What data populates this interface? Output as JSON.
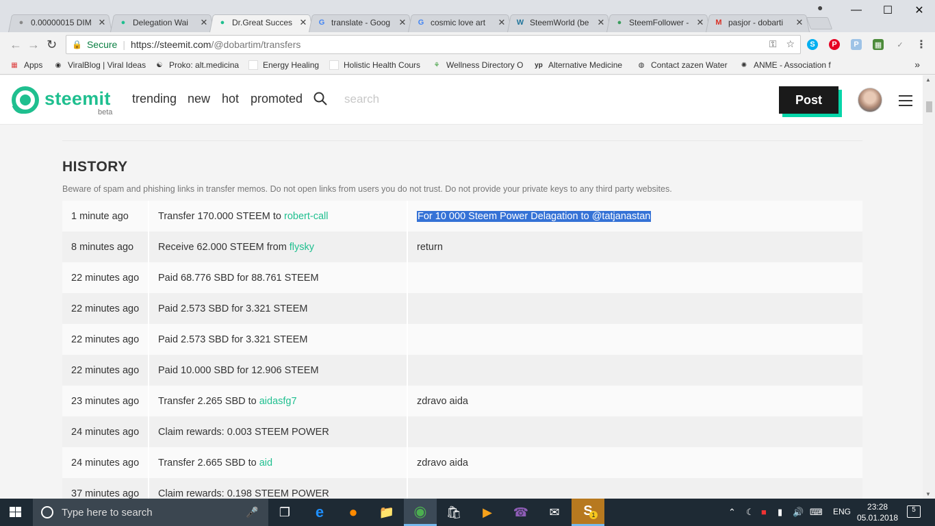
{
  "browser": {
    "tabs": [
      {
        "title": "0.00000015 DIM",
        "icon": "share-nodes-icon",
        "color": "#888888"
      },
      {
        "title": "Delegation Wai",
        "icon": "steemit-icon",
        "color": "#1fbf8f"
      },
      {
        "title": "Dr.Great Succes",
        "icon": "steemit-icon",
        "color": "#1fbf8f"
      },
      {
        "title": "translate - Goog",
        "icon": "google-icon",
        "color": "#4285f4"
      },
      {
        "title": "cosmic love art",
        "icon": "google-icon",
        "color": "#4285f4"
      },
      {
        "title": "SteemWorld (be",
        "icon": "wordpress-icon",
        "color": "#21759b"
      },
      {
        "title": "SteemFollower -",
        "icon": "steemfollower-icon",
        "color": "#3a9d5d"
      },
      {
        "title": "pasjor - dobarti",
        "icon": "gmail-icon",
        "color": "#d93025"
      }
    ],
    "address": {
      "secure_label": "Secure",
      "url_host": "https://steemit.com",
      "url_path": "/@dobartim/transfers"
    },
    "bookmarks": [
      {
        "label": "Apps",
        "icon": "apps-grid-icon"
      },
      {
        "label": "ViralBlog | Viral Ideas",
        "icon": "viralblog-icon"
      },
      {
        "label": "Proko: alt.medicina",
        "icon": "proko-icon"
      },
      {
        "label": "Energy Healing",
        "icon": "page-icon"
      },
      {
        "label": "Holistic Health Cours",
        "icon": "page-icon"
      },
      {
        "label": "Wellness Directory O",
        "icon": "sprout-icon"
      },
      {
        "label": "Alternative Medicine",
        "icon": "yp-icon"
      },
      {
        "label": "Contact zazen Water",
        "icon": "globe-icon"
      },
      {
        "label": "ANME - Association f",
        "icon": "sun-icon"
      }
    ],
    "bookmarks_more": "»"
  },
  "steemit": {
    "logo_text": "steemit",
    "beta_label": "beta",
    "nav": [
      "trending",
      "new",
      "hot",
      "promoted"
    ],
    "search_placeholder": "search",
    "post_label": "Post"
  },
  "history": {
    "title": "HISTORY",
    "warning": "Beware of spam and phishing links in transfer memos. Do not open links from users you do not trust. Do not provide your private keys to any third party websites.",
    "rows": [
      {
        "time": "1 minute ago",
        "action": "Transfer 170.000 STEEM to",
        "link": "robert-call",
        "memo": "For 10 000 Steem Power Delagation to @tatjanastan",
        "selected": true
      },
      {
        "time": "8 minutes ago",
        "action": "Receive 62.000 STEEM from",
        "link": "flysky",
        "memo": "return"
      },
      {
        "time": "22 minutes ago",
        "action": "Paid 68.776 SBD for 88.761 STEEM",
        "link": "",
        "memo": ""
      },
      {
        "time": "22 minutes ago",
        "action": "Paid 2.573 SBD for 3.321 STEEM",
        "link": "",
        "memo": ""
      },
      {
        "time": "22 minutes ago",
        "action": "Paid 2.573 SBD for 3.321 STEEM",
        "link": "",
        "memo": ""
      },
      {
        "time": "22 minutes ago",
        "action": "Paid 10.000 SBD for 12.906 STEEM",
        "link": "",
        "memo": ""
      },
      {
        "time": "23 minutes ago",
        "action": "Transfer 2.265 SBD to",
        "link": "aidasfg7",
        "memo": "zdravo aida"
      },
      {
        "time": "24 minutes ago",
        "action": "Claim rewards: 0.003 STEEM POWER",
        "link": "",
        "memo": ""
      },
      {
        "time": "24 minutes ago",
        "action": "Transfer 2.665 SBD to",
        "link": "aid",
        "memo": "zdravo aida"
      },
      {
        "time": "37 minutes ago",
        "action": "Claim rewards: 0.198 STEEM POWER",
        "link": "",
        "memo": ""
      }
    ]
  },
  "taskbar": {
    "search_placeholder": "Type here to search",
    "language": "ENG",
    "time": "23:28",
    "date": "05.01.2018",
    "notification_count": "5",
    "skype_badge": "1"
  }
}
